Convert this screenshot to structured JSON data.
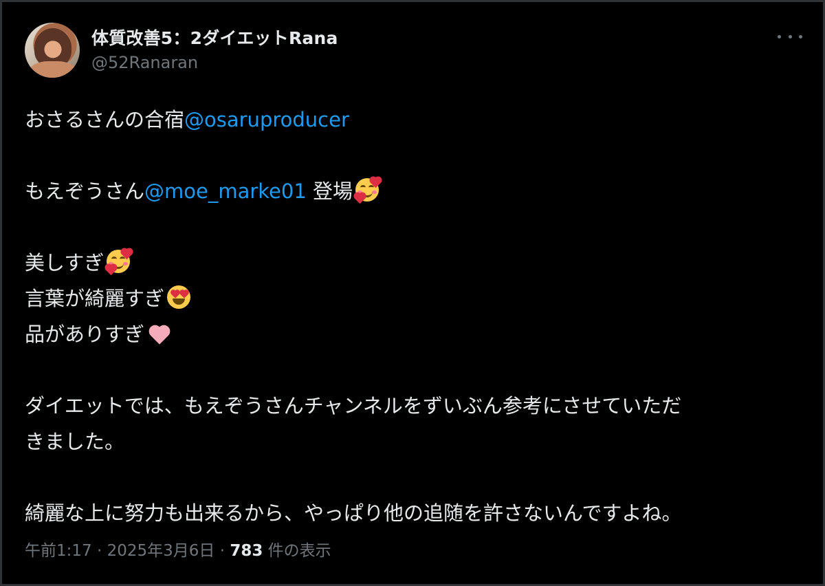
{
  "author": {
    "display_name": "体質改善5：2ダイエットRana",
    "handle": "@52Ranaran"
  },
  "tweet": {
    "line1_text": "おさるさんの合宿",
    "line1_mention": "@osaruproducer",
    "line2_text_before": "もえぞうさん",
    "line2_mention": "@moe_marke01",
    "line2_text_after": " 登場",
    "line3": "美しすぎ",
    "line4": "言葉が綺麗すぎ",
    "line5": "品がありすぎ",
    "line6": "ダイエットでは、もえぞうさんチャンネルをずいぶん参考にさせていただ",
    "line7": "きました。",
    "line8": "綺麗な上に努力も出来るから、やっぱり他の追随を許さないんですよね。"
  },
  "meta": {
    "time": "午前1:17",
    "separator": " · ",
    "date": "2025年3月6日",
    "views_count": "783",
    "views_label": " 件の表示"
  },
  "icons": {
    "more": "more-options-icon",
    "emoji_smiling_hearts": "smiling-face-with-hearts-emoji",
    "emoji_heart_eyes": "heart-eyes-emoji",
    "emoji_pink_heart": "pink-heart-emoji"
  },
  "colors": {
    "background": "#000000",
    "text": "#e7e9ea",
    "secondary": "#71767b",
    "link": "#1d9bf0"
  }
}
